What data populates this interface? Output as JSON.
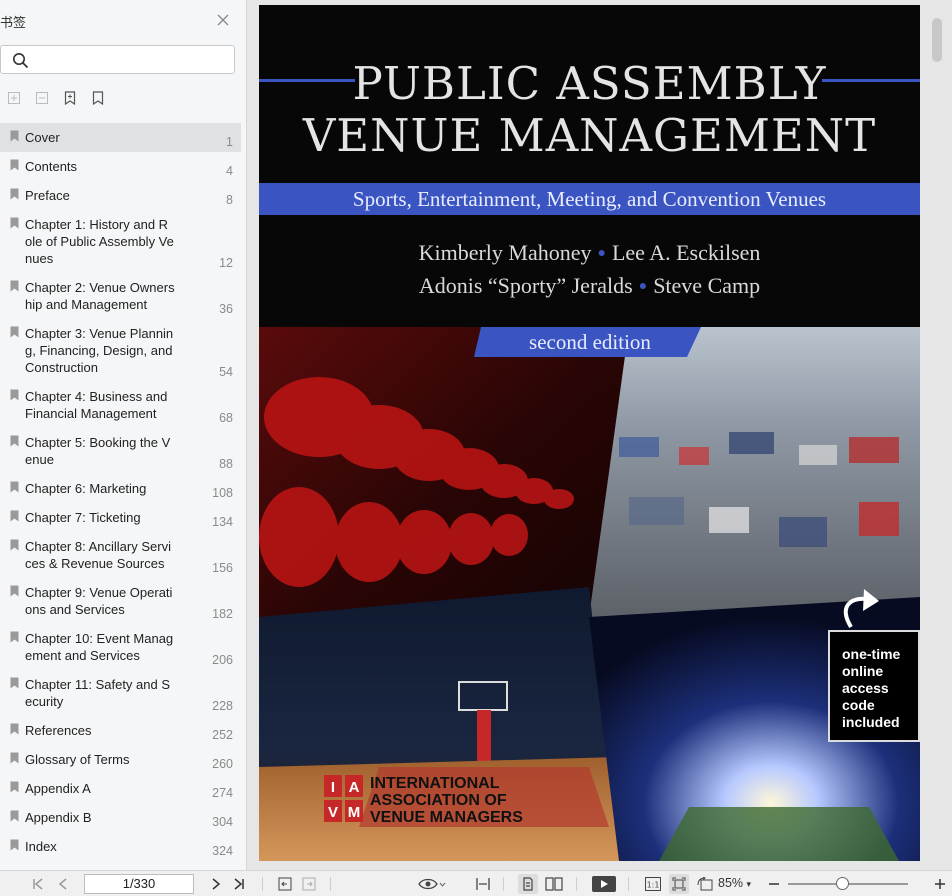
{
  "sidebar": {
    "title": "书签",
    "search": {
      "value": "",
      "placeholder": ""
    },
    "tools": [
      "expand-all-icon",
      "collapse-all-icon",
      "add-bookmark-icon",
      "bookmark-icon"
    ],
    "bookmarks": [
      {
        "label": "Cover",
        "page": "1",
        "selected": true
      },
      {
        "label": "Contents",
        "page": "4"
      },
      {
        "label": "Preface",
        "page": "8"
      },
      {
        "label": "Chapter 1: History and Role of Public Assembly Venues",
        "page": "12"
      },
      {
        "label": "Chapter 2: Venue Ownership and Management",
        "page": "36"
      },
      {
        "label": "Chapter 3: Venue Planning, Financing, Design, and Construction",
        "page": "54"
      },
      {
        "label": "Chapter 4: Business and Financial Management",
        "page": "68"
      },
      {
        "label": "Chapter 5: Booking the Venue",
        "page": "88"
      },
      {
        "label": "Chapter 6: Marketing",
        "page": "108"
      },
      {
        "label": "Chapter 7: Ticketing",
        "page": "134"
      },
      {
        "label": "Chapter 8: Ancillary Services & Revenue Sources",
        "page": "156"
      },
      {
        "label": "Chapter 9: Venue Operations and Services",
        "page": "182"
      },
      {
        "label": "Chapter 10: Event Management and Services",
        "page": "206"
      },
      {
        "label": "Chapter 11: Safety and Security",
        "page": "228"
      },
      {
        "label": "References",
        "page": "252"
      },
      {
        "label": "Glossary of Terms",
        "page": "260"
      },
      {
        "label": "Appendix A",
        "page": "274"
      },
      {
        "label": "Appendix B",
        "page": "304"
      },
      {
        "label": "Index",
        "page": "324"
      }
    ]
  },
  "cover": {
    "title_line1": "PUBLIC ASSEMBLY",
    "title_line2": "VENUE MANAGEMENT",
    "subtitle": "Sports, Entertainment, Meeting, and Convention Venues",
    "author1": "Kimberly Mahoney",
    "author2": "Lee A. Esckilsen",
    "author3": "Adonis “Sporty” Jeralds",
    "author4": "Steve Camp",
    "edition": "second edition",
    "access_line1": "one-time",
    "access_line2": "online",
    "access_line3": "access",
    "access_line4": "code",
    "access_line5": "included",
    "logo_letters": [
      "I",
      "A",
      "V",
      "M"
    ],
    "org_line1": "INTERNATIONAL",
    "org_line2": "ASSOCIATION OF",
    "org_line3": "VENUE MANAGERS",
    "accent_color": "#3a55c2"
  },
  "statusbar": {
    "page_indicator": "1/330",
    "zoom": "85%",
    "zoom_slider_fraction": 0.45
  }
}
